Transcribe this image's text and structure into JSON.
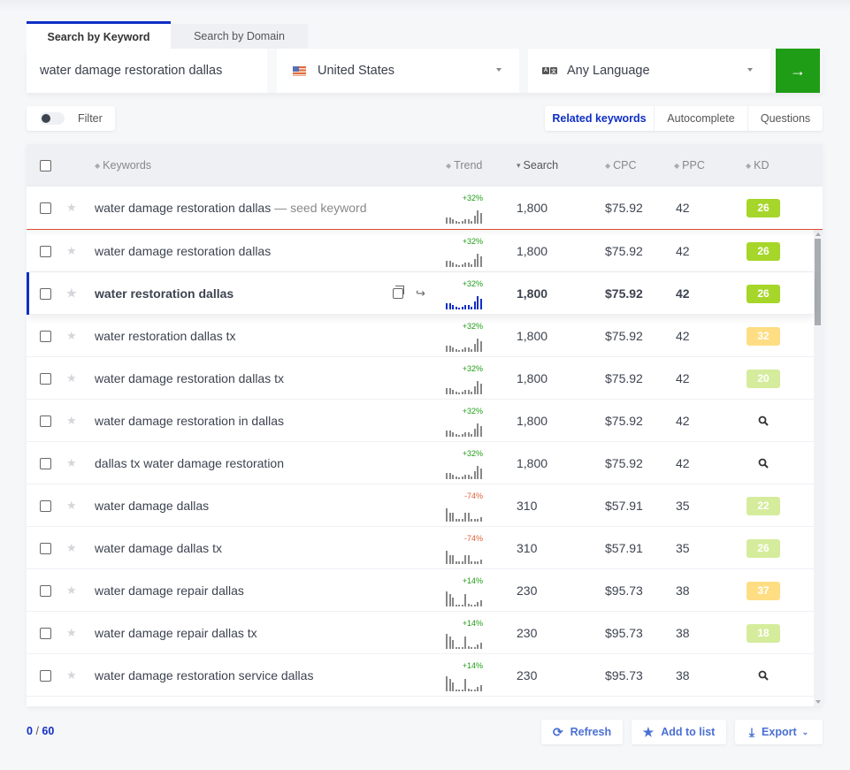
{
  "tabs": [
    {
      "label": "Search by Keyword",
      "active": true
    },
    {
      "label": "Search by Domain",
      "active": false
    }
  ],
  "search": {
    "keyword_value": "water damage restoration dallas",
    "country": "United States",
    "country_icon": "us-flag-icon",
    "language": "Any Language",
    "language_icon": "translate-icon",
    "go_icon": "arrow-right-icon",
    "go_color": "#1f9d16"
  },
  "filter": {
    "label": "Filter",
    "enabled": false
  },
  "modes": [
    {
      "label": "Related keywords",
      "active": true
    },
    {
      "label": "Autocomplete",
      "active": false
    },
    {
      "label": "Questions",
      "active": false
    }
  ],
  "table": {
    "columns": {
      "keywords": "Keywords",
      "trend": "Trend",
      "search": "Search",
      "cpc": "CPC",
      "ppc": "PPC",
      "kd": "KD"
    },
    "sorted_by": "search",
    "seed_suffix": "— seed keyword",
    "rows": [
      {
        "keyword": "water damage restoration dallas",
        "seed": true,
        "trend_pct": "+32%",
        "trend": [
          4,
          4,
          3,
          2,
          1,
          2,
          3,
          3,
          2,
          5,
          9,
          7
        ],
        "search": "1,800",
        "cpc": "$75.92",
        "ppc": "42",
        "kd": "26",
        "kd_color": "#a6d62a"
      },
      {
        "keyword": "water damage restoration dallas",
        "trend_pct": "+32%",
        "trend": [
          4,
          4,
          3,
          2,
          1,
          2,
          3,
          3,
          2,
          5,
          9,
          7
        ],
        "search": "1,800",
        "cpc": "$75.92",
        "ppc": "42",
        "kd": "26",
        "kd_color": "#a6d62a"
      },
      {
        "keyword": "water restoration dallas",
        "hover": true,
        "trend_pct": "+32%",
        "trend": [
          4,
          4,
          3,
          2,
          1,
          2,
          3,
          3,
          2,
          5,
          9,
          7
        ],
        "search": "1,800",
        "cpc": "$75.92",
        "ppc": "42",
        "kd": "26",
        "kd_color": "#a6d62a"
      },
      {
        "keyword": "water restoration dallas tx",
        "trend_pct": "+32%",
        "trend": [
          4,
          4,
          3,
          2,
          1,
          2,
          3,
          3,
          2,
          5,
          9,
          7
        ],
        "search": "1,800",
        "cpc": "$75.92",
        "ppc": "42",
        "kd": "32",
        "kd_color": "#fedd83"
      },
      {
        "keyword": "water damage restoration dallas tx",
        "trend_pct": "+32%",
        "trend": [
          4,
          4,
          3,
          2,
          1,
          2,
          3,
          3,
          2,
          5,
          9,
          7
        ],
        "search": "1,800",
        "cpc": "$75.92",
        "ppc": "42",
        "kd": "20",
        "kd_color": "#d5ec9c"
      },
      {
        "keyword": "water damage restoration in dallas",
        "trend_pct": "+32%",
        "trend": [
          4,
          4,
          3,
          2,
          1,
          2,
          3,
          3,
          2,
          5,
          9,
          7
        ],
        "search": "1,800",
        "cpc": "$75.92",
        "ppc": "42",
        "kd": null
      },
      {
        "keyword": "dallas tx water damage restoration",
        "trend_pct": "+32%",
        "trend": [
          4,
          4,
          3,
          2,
          1,
          2,
          3,
          3,
          2,
          5,
          9,
          7
        ],
        "search": "1,800",
        "cpc": "$75.92",
        "ppc": "42",
        "kd": null
      },
      {
        "keyword": "water damage dallas",
        "trend_pct": "-74%",
        "trend": [
          9,
          6,
          6,
          2,
          2,
          2,
          6,
          6,
          2,
          2,
          2,
          3
        ],
        "search": "310",
        "cpc": "$57.91",
        "ppc": "35",
        "kd": "22",
        "kd_color": "#d5ec9c"
      },
      {
        "keyword": "water damage dallas tx",
        "trend_pct": "-74%",
        "trend": [
          9,
          6,
          6,
          2,
          2,
          2,
          6,
          6,
          2,
          2,
          2,
          3
        ],
        "search": "310",
        "cpc": "$57.91",
        "ppc": "35",
        "kd": "26",
        "kd_color": "#d5ec9c"
      },
      {
        "keyword": "water damage repair dallas",
        "trend_pct": "+14%",
        "trend": [
          10,
          8,
          6,
          1,
          1,
          1,
          8,
          2,
          1,
          1,
          3,
          4
        ],
        "search": "230",
        "cpc": "$95.73",
        "ppc": "38",
        "kd": "37",
        "kd_color": "#fedd83"
      },
      {
        "keyword": "water damage repair dallas tx",
        "trend_pct": "+14%",
        "trend": [
          10,
          8,
          6,
          1,
          1,
          1,
          8,
          2,
          1,
          1,
          3,
          4
        ],
        "search": "230",
        "cpc": "$95.73",
        "ppc": "38",
        "kd": "18",
        "kd_color": "#d5ec9c"
      },
      {
        "keyword": "water damage restoration service dallas",
        "trend_pct": "+14%",
        "trend": [
          10,
          8,
          6,
          1,
          1,
          1,
          8,
          2,
          1,
          1,
          3,
          4
        ],
        "search": "230",
        "cpc": "$95.73",
        "ppc": "38",
        "kd": null
      }
    ]
  },
  "colors": {
    "accent": "#0f2fc5",
    "positive": "#1f9d16",
    "negative": "#e0603a",
    "seed_line": "#e04a32"
  },
  "footer": {
    "selected": "0",
    "total": "60",
    "separator": "/",
    "refresh_label": "Refresh",
    "add_to_list_label": "Add to list",
    "export_label": "Export"
  }
}
